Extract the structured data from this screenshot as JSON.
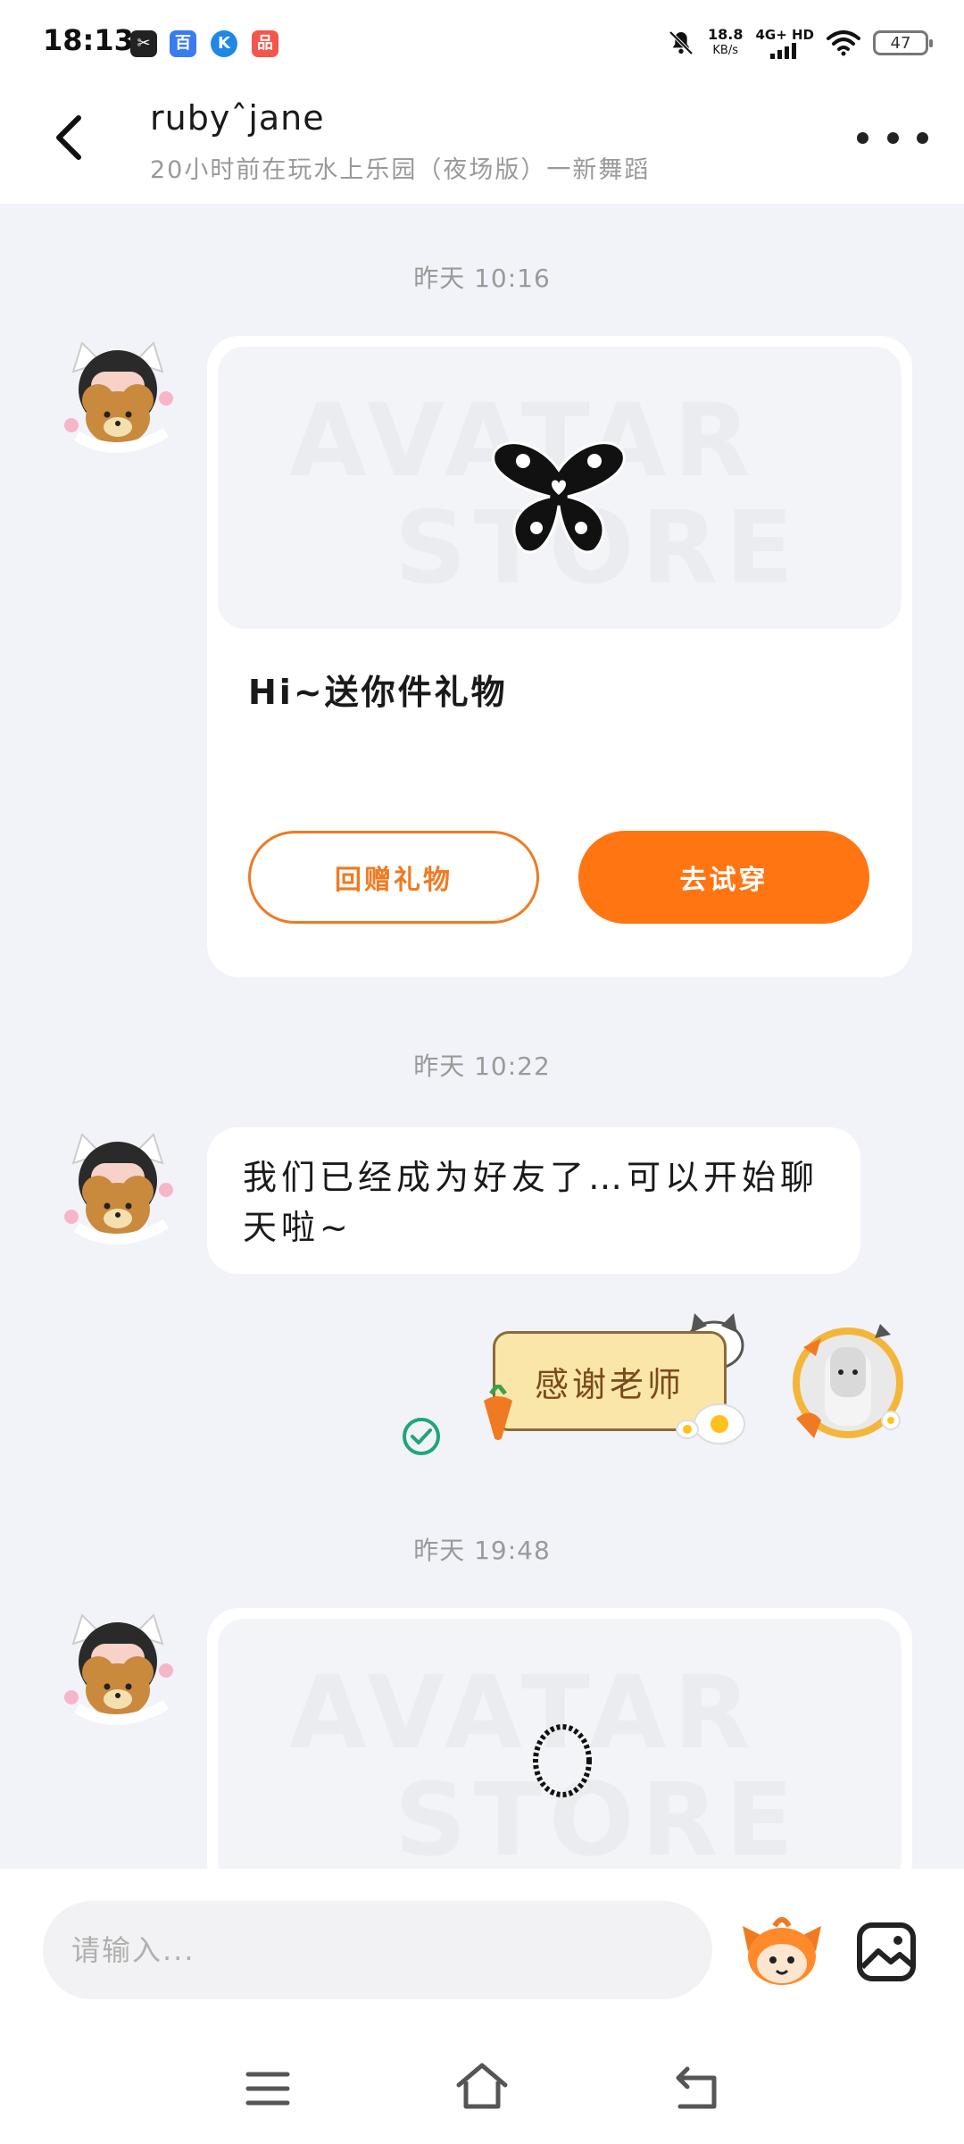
{
  "status_bar": {
    "time": "18:13",
    "net_speed_value": "18.8",
    "net_speed_unit": "KB/s",
    "network_type": "4G+ HD",
    "battery": "47"
  },
  "header": {
    "name": "rubyˆjane",
    "status": "20小时前在玩水上乐园（夜场版）一新舞蹈"
  },
  "messages": {
    "timestamp_1": "昨天 10:16",
    "timestamp_2": "昨天 10:22",
    "timestamp_3": "昨天 19:48",
    "gift_card": {
      "watermark_line1": "AVATAR",
      "watermark_line2": "STORE",
      "text": "Hi~送你件礼物",
      "return_gift_label": "回赠礼物",
      "try_on_label": "去试穿"
    },
    "friend_text": "我们已经成为好友了…可以开始聊天啦~",
    "sticker_text": "感谢老师"
  },
  "input": {
    "placeholder": "请输入..."
  },
  "colors": {
    "accent": "#FF7512",
    "background": "#F2F3F8",
    "sent_check": "#1FA67A"
  }
}
